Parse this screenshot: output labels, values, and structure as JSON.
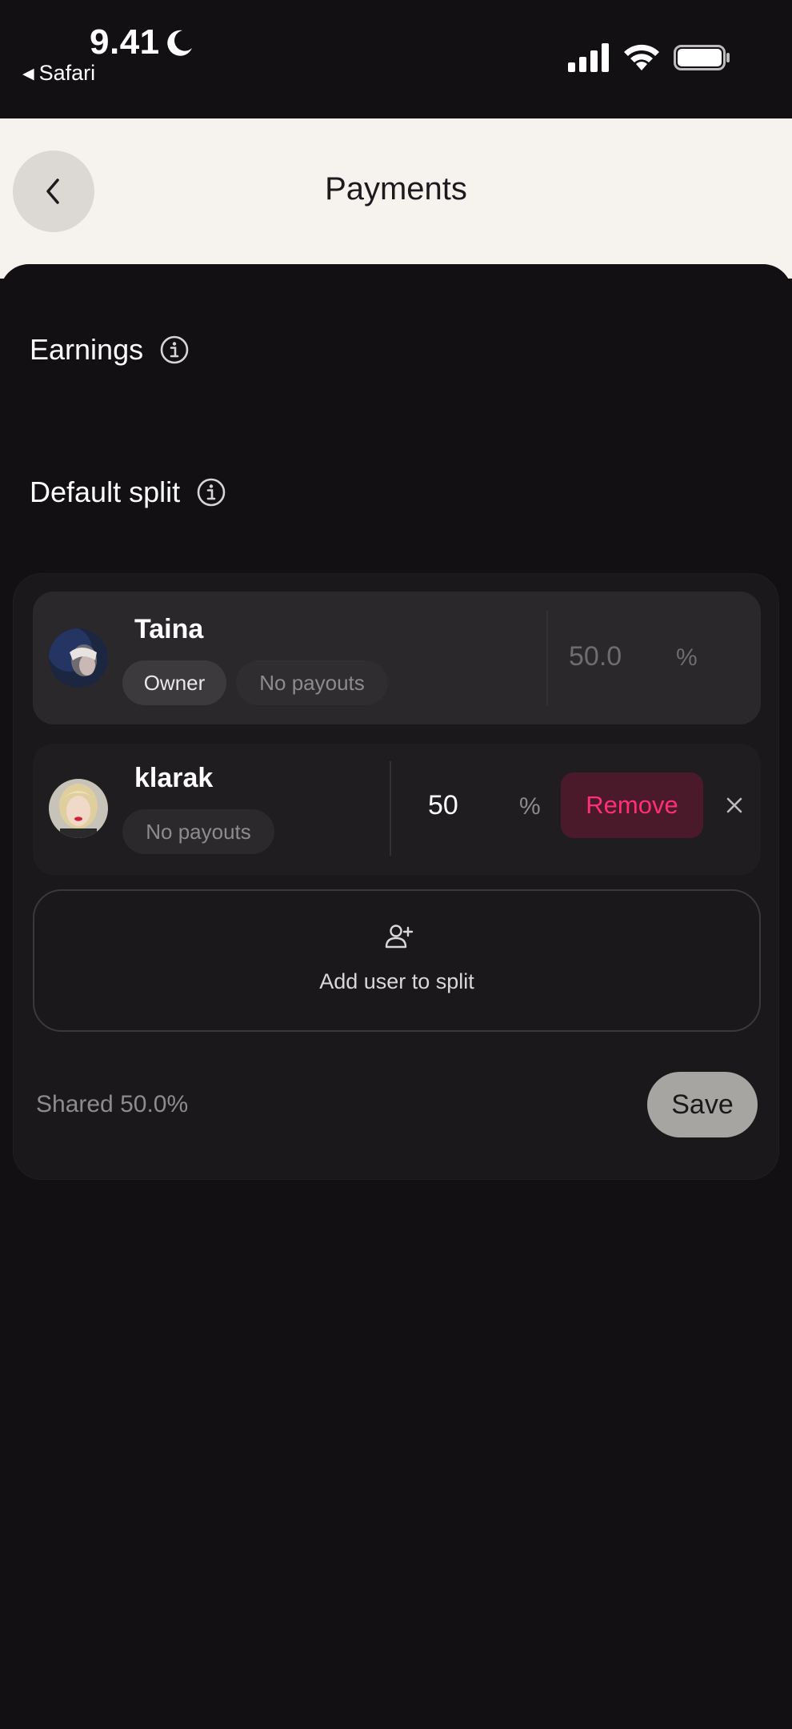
{
  "status_bar": {
    "time": "9.41",
    "back_app": "Safari"
  },
  "header": {
    "title": "Payments"
  },
  "sections": {
    "earnings": "Earnings",
    "default_split": "Default split"
  },
  "split": {
    "members": [
      {
        "name": "Taina",
        "badges": [
          "Owner",
          "No payouts"
        ],
        "percent": "50.0",
        "percent_sign": "%"
      },
      {
        "name": "klarak",
        "badges": [
          "No payouts"
        ],
        "percent": "50",
        "percent_sign": "%",
        "remove_label": "Remove"
      }
    ],
    "add_user_label": "Add user to split",
    "shared_text": "Shared 50.0%",
    "save_label": "Save"
  },
  "icons": {
    "back": "chevron-left-icon",
    "info": "info-icon",
    "add_user": "user-plus-icon",
    "close": "close-icon",
    "moon": "moon-icon",
    "signal": "signal-icon",
    "wifi": "wifi-icon",
    "battery": "battery-icon"
  },
  "colors": {
    "background": "#121013",
    "header_bg": "#f6f3ee",
    "remove_text": "#ff2e78",
    "remove_bg": "#4a1a2b",
    "save_bg": "#a7a5a2"
  }
}
